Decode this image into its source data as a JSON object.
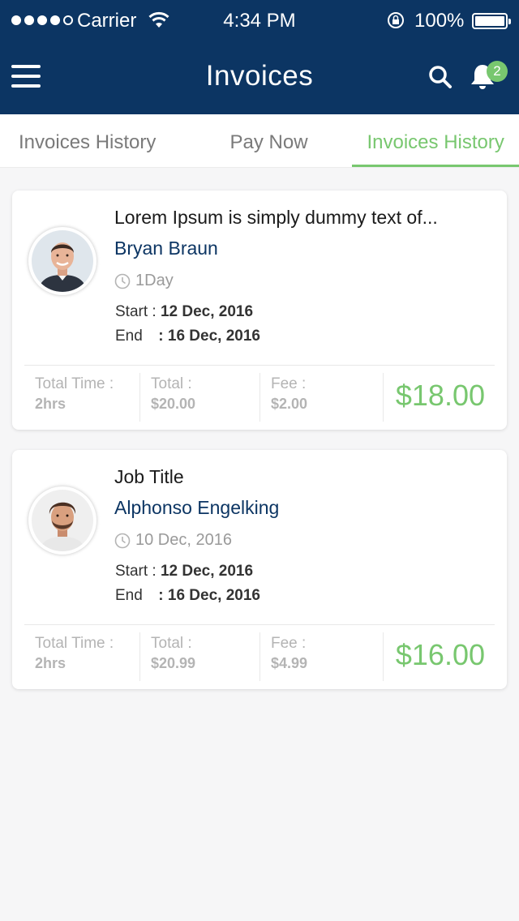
{
  "status_bar": {
    "carrier": "Carrier",
    "time": "4:34 PM",
    "battery": "100%"
  },
  "header": {
    "title": "Invoices",
    "notification_count": "2",
    "colors": {
      "background": "#0c3563",
      "accent": "#78c76f"
    }
  },
  "tabs": [
    {
      "label": "Invoices History",
      "active": false
    },
    {
      "label": "Pay Now",
      "active": false
    },
    {
      "label": "Invoices History",
      "active": true
    }
  ],
  "invoices": [
    {
      "title": "Lorem Ipsum is simply dummy text of...",
      "name": "Bryan Braun",
      "meta": "1Day",
      "start_label": "Start :",
      "start_value": "12 Dec, 2016",
      "end_label": "End",
      "end_value": ": 16 Dec, 2016",
      "total_time_label": "Total Time :",
      "total_time_value": "2hrs",
      "total_label": "Total :",
      "total_value": "$20.00",
      "fee_label": "Fee :",
      "fee_value": "$2.00",
      "amount": "$18.00"
    },
    {
      "title": "Job Title",
      "name": "Alphonso Engelking",
      "meta": "10 Dec, 2016",
      "start_label": "Start :",
      "start_value": "12 Dec, 2016",
      "end_label": "End",
      "end_value": ": 16 Dec, 2016",
      "total_time_label": "Total Time :",
      "total_time_value": "2hrs",
      "total_label": "Total :",
      "total_value": "$20.99",
      "fee_label": "Fee :",
      "fee_value": "$4.99",
      "amount": "$16.00"
    }
  ]
}
